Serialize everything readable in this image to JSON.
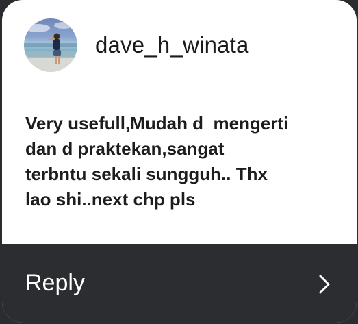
{
  "comment": {
    "username": "dave_h_winata",
    "message": "Very usefull,Mudah d  mengerti\ndan d praktekan,sangat\nterbntu sekali sungguh.. Thx\nlao shi..next chp pls",
    "reply_label": "Reply",
    "avatar_icon": "profile-photo",
    "chevron_icon": "chevron-right-icon"
  },
  "colors": {
    "card_bg": "#ffffff",
    "footer_bg": "#2c2d30",
    "text_dark": "#1d1d1d",
    "reply_text": "#ffffff"
  }
}
